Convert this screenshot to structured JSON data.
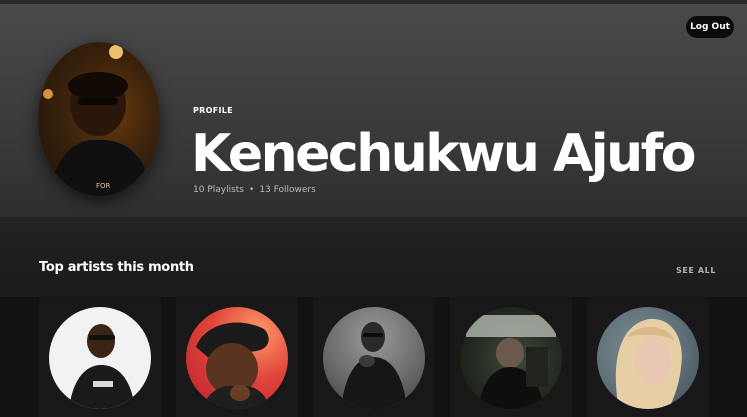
{
  "header": {
    "logout_label": "Log Out",
    "profile_label": "PROFILE",
    "name": "Kenechukwu Ajufo",
    "playlists": "10 Playlists",
    "separator": "•",
    "followers": "13 Followers"
  },
  "section": {
    "title": "Top artists this month",
    "see_all": "SEE ALL"
  },
  "artists_count_shown": 5,
  "colors": {
    "background": "#121212",
    "header_top": "#4a4a4a",
    "card": "#181818",
    "button": "#0b0b0b"
  }
}
